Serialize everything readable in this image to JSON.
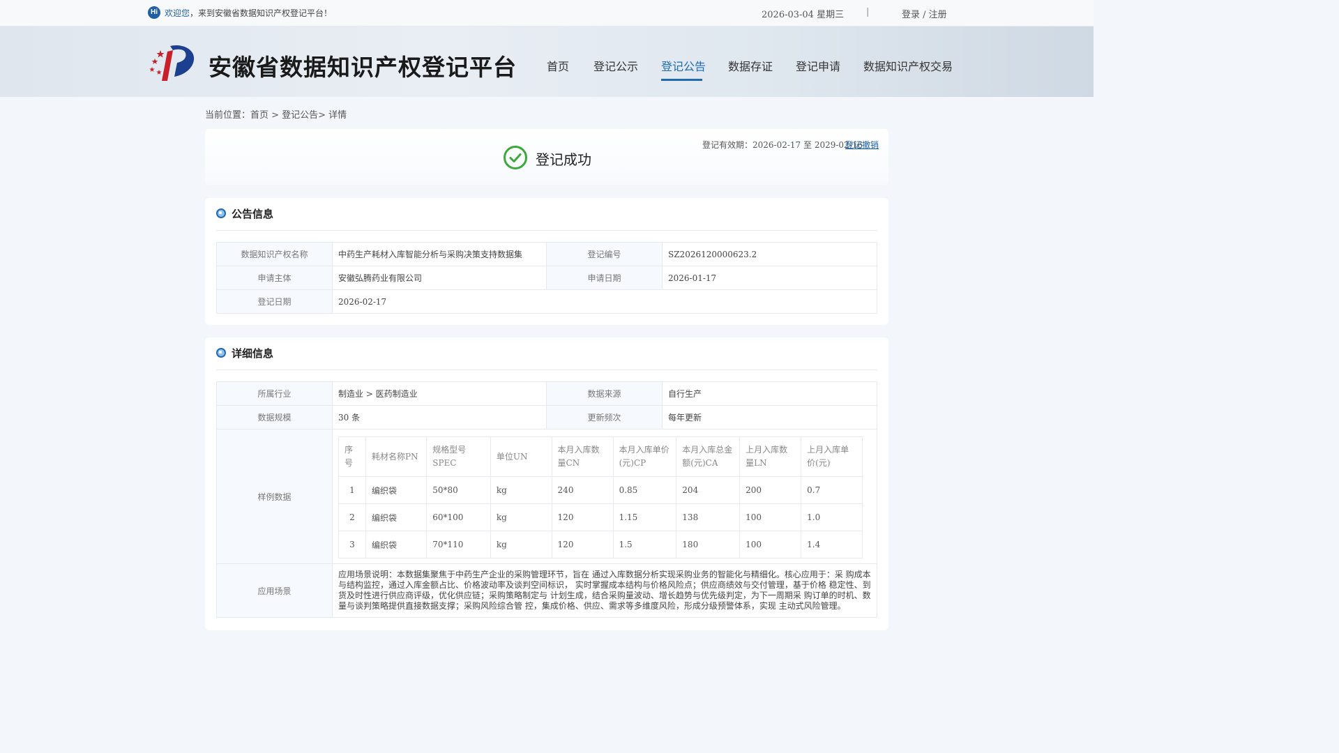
{
  "topbar": {
    "hi": "Hi",
    "welcome_prefix": "欢迎您",
    "welcome_suffix": "，来到安徽省数据知识产权登记平台！",
    "date": "2026-03-04 星期三",
    "separator": "|",
    "login": "登录 / 注册"
  },
  "header": {
    "title": "安徽省数据知识产权登记平台",
    "nav": [
      "首页",
      "登记公示",
      "登记公告",
      "数据存证",
      "登记申请",
      "数据知识产权交易"
    ],
    "active_nav": "登记公告"
  },
  "breadcrumb": "当前位置：首页 > 登记公告> 详情",
  "status": {
    "text": "登记成功",
    "validity": "登记有效期：2026-02-17 至 2029-02-16",
    "revoke": "登记撤销"
  },
  "announcement": {
    "title": "公告信息",
    "name_label": "数据知识产权名称",
    "name_value": "中药生产耗材入库智能分析与采购决策支持数据集",
    "reg_no_label": "登记编号",
    "reg_no_value": "SZ2026120000623.2",
    "applicant_label": "申请主体",
    "applicant_value": "安徽弘腾药业有限公司",
    "apply_date_label": "申请日期",
    "apply_date_value": "2026-01-17",
    "reg_date_label": "登记日期",
    "reg_date_value": "2026-02-17"
  },
  "detail": {
    "title": "详细信息",
    "industry_label": "所属行业",
    "industry_value": "制造业 > 医药制造业",
    "source_label": "数据来源",
    "source_value": "自行生产",
    "scale_label": "数据规模",
    "scale_value": "30 条",
    "freq_label": "更新频次",
    "freq_value": "每年更新",
    "sample_label": "样例数据",
    "sample_headers": [
      "序号",
      "耗材名称PN",
      "规格型号SPEC",
      "单位UN",
      "本月入库数量CN",
      "本月入库单价(元)CP",
      "本月入库总金额(元)CA",
      "上月入库数量LN",
      "上月入库单价(元)"
    ],
    "sample_rows": [
      [
        "1",
        "编织袋",
        "50*80",
        "kg",
        "240",
        "0.85",
        "204",
        "200",
        "0.7"
      ],
      [
        "2",
        "编织袋",
        "60*100",
        "kg",
        "120",
        "1.15",
        "138",
        "100",
        "1.0"
      ],
      [
        "3",
        "编织袋",
        "70*110",
        "kg",
        "120",
        "1.5",
        "180",
        "100",
        "1.4"
      ]
    ],
    "scene_label": "应用场景",
    "scene_value": "应用场景说明：本数据集聚焦于中药生产企业的采购管理环节，旨在 通过入库数据分析实现采购业务的智能化与精细化。核心应用于：采 购成本与结构监控，通过入库金额占比、价格波动率及谈判空间标识， 实时掌握成本结构与价格风险点；供应商绩效与交付管理，基于价格 稳定性、到货及时性进行供应商评级，优化供应链；采购策略制定与 计划生成，结合采购量波动、增长趋势与优先级判定，为下一周期采 购订单的时机、数量与谈判策略提供直接数据支撑；采购风险综合管 控，集成价格、供应、需求等多维度风险，形成分级预警体系，实现 主动式风险管理。"
  },
  "colors": {
    "accent": "#1f6ab3",
    "success": "#3aa93a"
  }
}
